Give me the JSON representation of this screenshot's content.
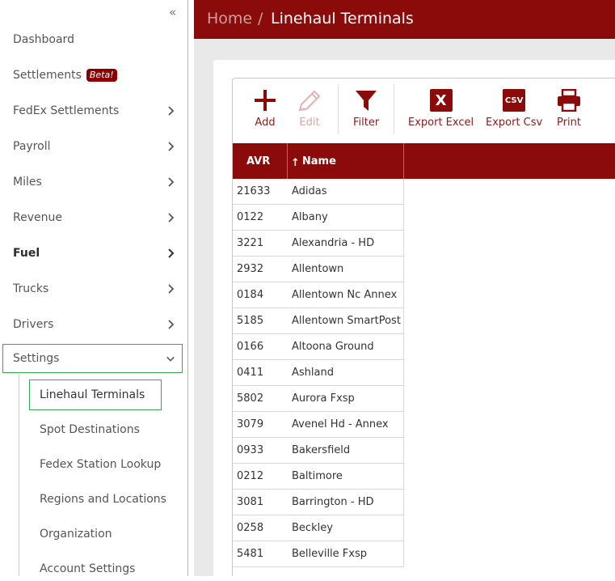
{
  "sidebar": {
    "collapse_icon": "double-chevron-left-icon",
    "items": [
      {
        "label": "Dashboard"
      },
      {
        "label": "Settlements",
        "badge": "Beta!"
      },
      {
        "label": "FedEx Settlements"
      },
      {
        "label": "Payroll"
      },
      {
        "label": "Miles"
      },
      {
        "label": "Revenue"
      },
      {
        "label": "Fuel"
      },
      {
        "label": "Trucks"
      },
      {
        "label": "Drivers"
      },
      {
        "label": "Settings"
      }
    ],
    "sub_items": [
      {
        "label": "Linehaul Terminals"
      },
      {
        "label": "Spot Destinations"
      },
      {
        "label": "Fedex Station Lookup"
      },
      {
        "label": "Regions and Locations"
      },
      {
        "label": "Organization"
      },
      {
        "label": "Account Settings"
      }
    ]
  },
  "header": {
    "home": "Home",
    "separator": "/",
    "current": "Linehaul Terminals"
  },
  "toolbar": {
    "add": "Add",
    "edit": "Edit",
    "filter": "Filter",
    "export_excel": "Export Excel",
    "export_csv": "Export Csv",
    "csv_icon_text": "CSV",
    "excel_icon_text": "X",
    "print": "Print"
  },
  "table": {
    "columns": [
      "AVR",
      "Name"
    ],
    "sort_indicator": "↑",
    "rows": [
      [
        "21633",
        "Adidas"
      ],
      [
        "0122",
        "Albany"
      ],
      [
        "3221",
        "Alexandria - HD"
      ],
      [
        "2932",
        "Allentown"
      ],
      [
        "0184",
        "Allentown Nc Annex"
      ],
      [
        "5185",
        "Allentown SmartPost"
      ],
      [
        "0166",
        "Altoona Ground"
      ],
      [
        "0411",
        "Ashland"
      ],
      [
        "5802",
        "Aurora Fxsp"
      ],
      [
        "3079",
        "Avenel Hd - Annex"
      ],
      [
        "0933",
        "Bakersfield"
      ],
      [
        "0212",
        "Baltimore"
      ],
      [
        "3081",
        "Barrington - HD"
      ],
      [
        "0258",
        "Beckley"
      ],
      [
        "5481",
        "Belleville Fxsp"
      ]
    ]
  },
  "colors": {
    "brand": "#8b0a0a",
    "active_outline": "#34a853"
  }
}
